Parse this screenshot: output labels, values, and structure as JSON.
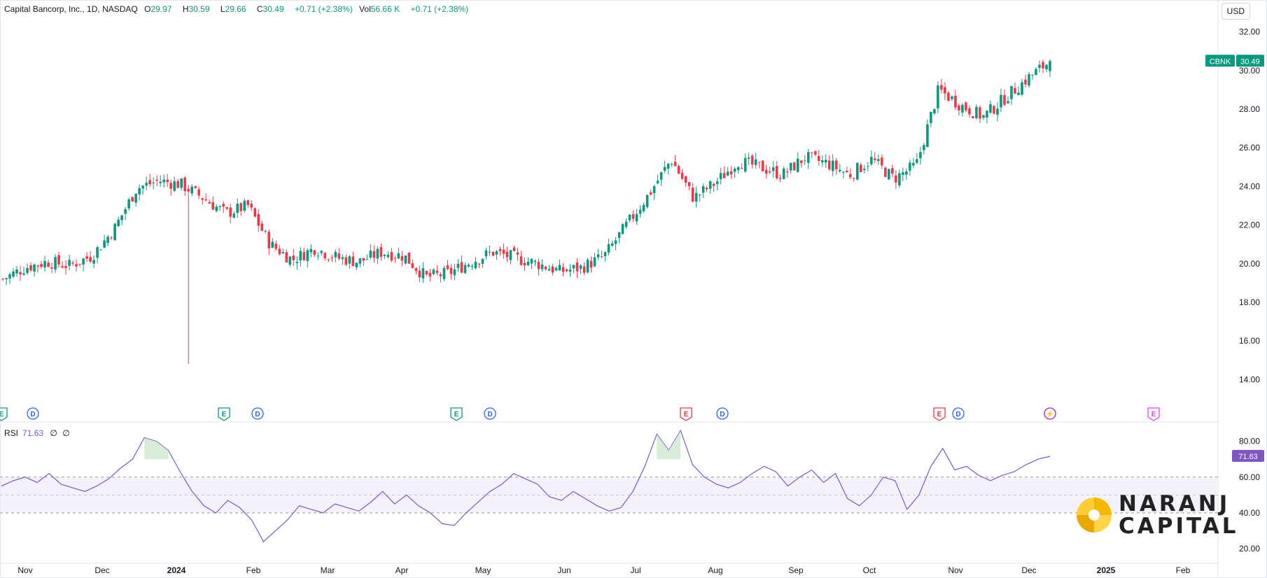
{
  "legend": {
    "title": "Capital Bancorp, Inc., 1D, NASDAQ",
    "o_label": "O",
    "o_value": "29.97",
    "h_label": "H",
    "h_value": "30.59",
    "l_label": "L",
    "l_value": "29.66",
    "c_label": "C",
    "c_value": "30.49",
    "change": "+0.71 (+2.38%)",
    "vol_label": "Vol",
    "vol_value": "56.66 K",
    "vol_change": "+0.71 (+2.38%)"
  },
  "currency_button": "USD",
  "price_tag": {
    "ticker": "CBNK",
    "price": "30.49"
  },
  "price_axis": [
    "32.00",
    "30.00",
    "28.00",
    "26.00",
    "24.00",
    "22.00",
    "20.00",
    "18.00",
    "16.00",
    "14.00"
  ],
  "rsi_axis": [
    "80.00",
    "60.00",
    "40.00",
    "20.00"
  ],
  "rsi_legend": {
    "label": "RSI",
    "value": "71.63",
    "extra1": "∅",
    "extra2": "∅"
  },
  "rsi_tag": "71.63",
  "x_axis": [
    "Nov",
    "Dec",
    "2024",
    "Feb",
    "Mar",
    "Apr",
    "May",
    "Jun",
    "Jul",
    "Aug",
    "Sep",
    "Oct",
    "Nov",
    "Dec",
    "2025",
    "Feb"
  ],
  "events": [
    {
      "type": "E",
      "kind": "earnings",
      "color": "#089981"
    },
    {
      "type": "D",
      "kind": "dividend",
      "color": "#2962ff"
    },
    {
      "type": "E",
      "kind": "earnings",
      "color": "#089981"
    },
    {
      "type": "D",
      "kind": "dividend",
      "color": "#2962ff"
    },
    {
      "type": "E",
      "kind": "earnings",
      "color": "#089981"
    },
    {
      "type": "D",
      "kind": "dividend",
      "color": "#2962ff"
    },
    {
      "type": "E",
      "kind": "earnings",
      "color": "#f23645"
    },
    {
      "type": "D",
      "kind": "dividend",
      "color": "#2962ff"
    },
    {
      "type": "E",
      "kind": "earnings",
      "color": "#f23645"
    },
    {
      "type": "D",
      "kind": "dividend",
      "color": "#2962ff"
    },
    {
      "type": "⚡",
      "kind": "split",
      "color": "#9c27b0"
    },
    {
      "type": "E",
      "kind": "earnings",
      "color": "#e040fb"
    }
  ],
  "logo": {
    "line1": "NARANJ",
    "line2": "CAPITAL"
  },
  "colors": {
    "up": "#089981",
    "down": "#f23645",
    "rsi": "#7e57c2"
  },
  "chart_data": [
    {
      "type": "candlestick",
      "title": "Capital Bancorp, Inc., 1D, NASDAQ",
      "ylim": [
        13,
        33
      ],
      "x": [
        "2023-10",
        "2023-11",
        "2023-12",
        "2024-01",
        "2024-02",
        "2024-03",
        "2024-04",
        "2024-05",
        "2024-06",
        "2024-07",
        "2024-08",
        "2024-09",
        "2024-10",
        "2024-11",
        "2024-12"
      ],
      "close_path": [
        19.2,
        19.8,
        20.1,
        19.9,
        20.4,
        21.8,
        23.9,
        24.3,
        24.1,
        23.4,
        22.6,
        23.0,
        21.0,
        20.2,
        20.8,
        20.3,
        20.1,
        20.6,
        20.4,
        19.3,
        19.5,
        20.1,
        20.6,
        20.3,
        20.0,
        19.6,
        19.8,
        20.4,
        22.0,
        23.6,
        25.4,
        23.4,
        24.2,
        25.3,
        25.0,
        24.6,
        25.5,
        25.2,
        24.6,
        25.4,
        24.4,
        25.1,
        29.0,
        28.2,
        27.6,
        28.6,
        29.6,
        30.49
      ],
      "last": {
        "open": 29.97,
        "high": 30.59,
        "low": 29.66,
        "close": 30.49
      }
    },
    {
      "type": "line",
      "title": "RSI",
      "ylim": [
        15,
        90
      ],
      "bands": [
        40,
        60
      ],
      "values": [
        55,
        58,
        60,
        57,
        62,
        56,
        54,
        52,
        55,
        59,
        65,
        70,
        82,
        80,
        75,
        63,
        52,
        44,
        40,
        47,
        43,
        36,
        24,
        30,
        36,
        44,
        42,
        40,
        45,
        43,
        41,
        46,
        52,
        45,
        50,
        44,
        40,
        34,
        33,
        40,
        46,
        52,
        56,
        62,
        59,
        56,
        49,
        47,
        52,
        48,
        44,
        41,
        43,
        52,
        66,
        84,
        75,
        86,
        67,
        60,
        56,
        54,
        57,
        62,
        66,
        63,
        55,
        60,
        64,
        57,
        62,
        48,
        44,
        50,
        60,
        58,
        42,
        50,
        66,
        76,
        64,
        66,
        61,
        58,
        61,
        63,
        67,
        70,
        71.63
      ]
    }
  ]
}
